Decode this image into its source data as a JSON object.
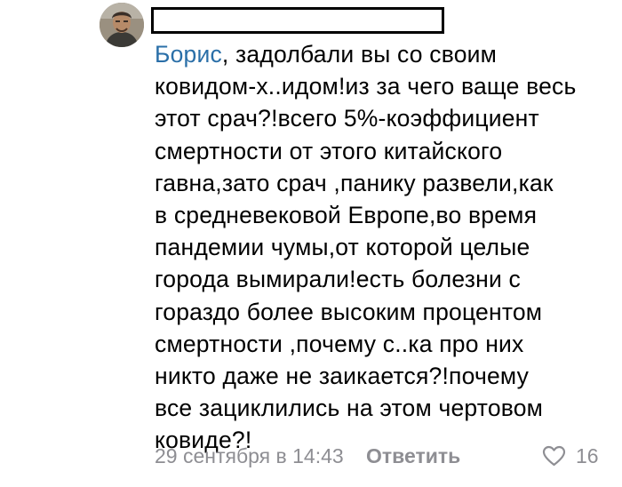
{
  "comment": {
    "avatar_icon": "user-avatar",
    "author_name_redacted": true,
    "mention": "Борис",
    "lines": [
      ", задолбали вы со своим",
      "ковидом-х..идом!из за чего ваще весь",
      "этот срач?!всего 5%-коэффициент",
      "смертности от этого китайского",
      "гавна,зато срач ,панику развели,как",
      "в средневековой Европе,во время",
      "пандемии чумы,от которой целые",
      "города вымирали!есть болезни с",
      "гораздо более высоким процентом",
      "смертности ,почему с..ка про них",
      "никто даже не заикается?!почему",
      "все зациклились на этом чертовом",
      "ковиде?!"
    ],
    "timestamp": "29 сентября в 14:43",
    "reply_label": "Ответить",
    "like_icon": "heart-icon",
    "like_count": "16"
  },
  "colors": {
    "mention": "#2a6fa8",
    "secondary_text": "#8e8e93",
    "text": "#000000",
    "background": "#ffffff"
  }
}
